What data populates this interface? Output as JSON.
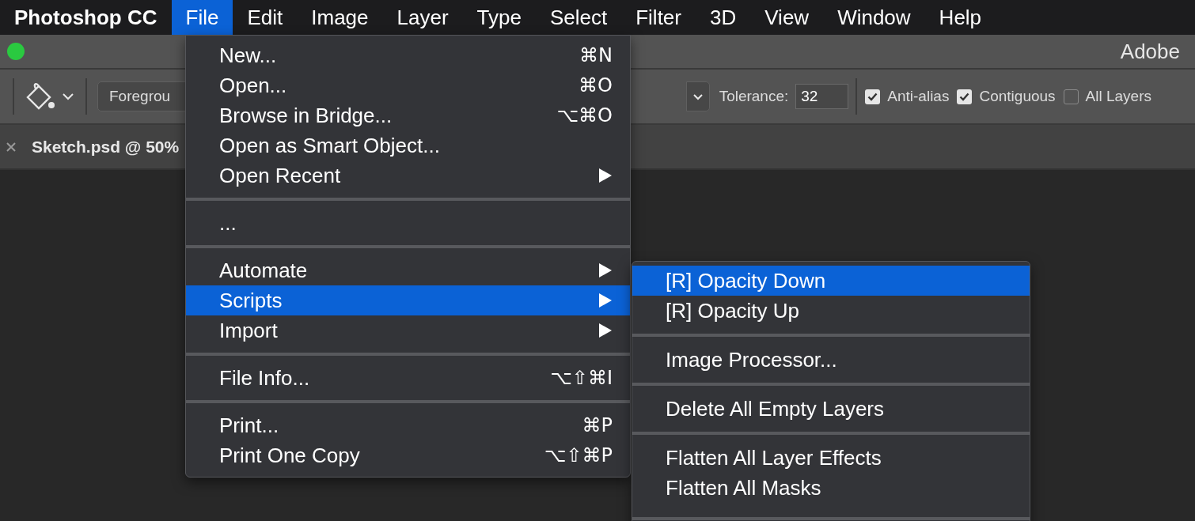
{
  "menu_bar": {
    "app_name": "Photoshop CC",
    "items": [
      {
        "label": "File",
        "selected": true
      },
      {
        "label": "Edit",
        "selected": false
      },
      {
        "label": "Image",
        "selected": false
      },
      {
        "label": "Layer",
        "selected": false
      },
      {
        "label": "Type",
        "selected": false
      },
      {
        "label": "Select",
        "selected": false
      },
      {
        "label": "Filter",
        "selected": false
      },
      {
        "label": "3D",
        "selected": false
      },
      {
        "label": "View",
        "selected": false
      },
      {
        "label": "Window",
        "selected": false
      },
      {
        "label": "Help",
        "selected": false
      }
    ]
  },
  "window": {
    "title": "Adobe"
  },
  "options_bar": {
    "fill_source": "Foregrou",
    "tolerance_label": "Tolerance:",
    "tolerance_value": "32",
    "checkboxes": [
      {
        "label": "Anti-alias",
        "checked": true
      },
      {
        "label": "Contiguous",
        "checked": true
      },
      {
        "label": "All Layers",
        "checked": false
      }
    ]
  },
  "document_tab": {
    "title": "Sketch.psd @ 50%"
  },
  "file_menu": {
    "groups": [
      [
        {
          "label": "New...",
          "shortcut": "⌘N",
          "submenu": false,
          "selected": false
        },
        {
          "label": "Open...",
          "shortcut": "⌘O",
          "submenu": false,
          "selected": false
        },
        {
          "label": "Browse in Bridge...",
          "shortcut": "⌥⌘O",
          "submenu": false,
          "selected": false
        },
        {
          "label": "Open as Smart Object...",
          "submenu": false,
          "selected": false
        },
        {
          "label": "Open Recent",
          "submenu": true,
          "selected": false
        }
      ],
      [
        {
          "label": "...",
          "submenu": false,
          "selected": false
        }
      ],
      [
        {
          "label": "Automate",
          "submenu": true,
          "selected": false
        },
        {
          "label": "Scripts",
          "submenu": true,
          "selected": true
        },
        {
          "label": "Import",
          "submenu": true,
          "selected": false
        }
      ],
      [
        {
          "label": "File Info...",
          "shortcut": "⌥⇧⌘I",
          "submenu": false,
          "selected": false
        }
      ],
      [
        {
          "label": "Print...",
          "shortcut": "⌘P",
          "submenu": false,
          "selected": false
        },
        {
          "label": "Print One Copy",
          "shortcut": "⌥⇧⌘P",
          "submenu": false,
          "selected": false
        }
      ]
    ]
  },
  "scripts_submenu": {
    "groups": [
      [
        {
          "label": "[R] Opacity Down",
          "selected": true
        },
        {
          "label": "[R] Opacity Up",
          "selected": false
        }
      ],
      [
        {
          "label": "Image Processor...",
          "selected": false
        }
      ],
      [
        {
          "label": "Delete All Empty Layers",
          "selected": false
        }
      ],
      [
        {
          "label": "Flatten All Layer Effects",
          "selected": false
        },
        {
          "label": "Flatten All Masks",
          "selected": false
        }
      ]
    ]
  }
}
